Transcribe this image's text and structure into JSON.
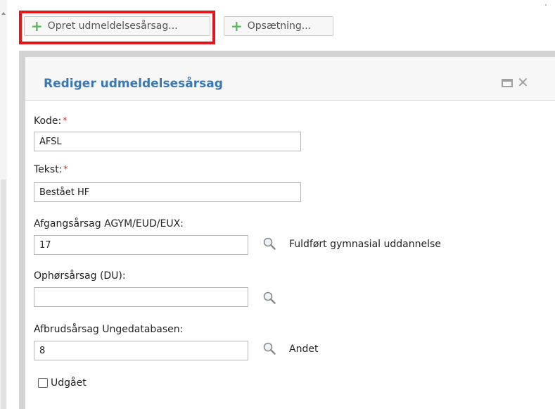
{
  "toolbar": {
    "create_label": "Opret udmeldelsesårsag...",
    "setup_label": "Opsætning..."
  },
  "dialog": {
    "title": "Rediger udmeldelsesårsag",
    "fields": {
      "kode": {
        "label": "Kode:",
        "required_mark": "*",
        "value": "AFSL"
      },
      "tekst": {
        "label": "Tekst:",
        "required_mark": "*",
        "value": "Bestået HF"
      },
      "afgang": {
        "label": "Afgangsårsag AGYM/EUD/EUX:",
        "value": "17",
        "lookup_text": "Fuldført gymnasial uddannelse"
      },
      "ophor": {
        "label": "Ophørsårsag (DU):",
        "value": "",
        "lookup_text": ""
      },
      "afbrud": {
        "label": "Afbrudsårsag Ungedatabasen:",
        "value": "8",
        "lookup_text": "Andet"
      }
    },
    "checkbox": {
      "label": "Udgået",
      "checked": false
    }
  },
  "icons": {
    "add": "plus-icon",
    "lookup": "magnifier-icon",
    "maximize": "maximize-icon",
    "close": "close-icon"
  },
  "colors": {
    "highlight": "#e3161b",
    "title": "#3b78b2",
    "plus": "#5cb85c",
    "required": "#d9251c"
  }
}
